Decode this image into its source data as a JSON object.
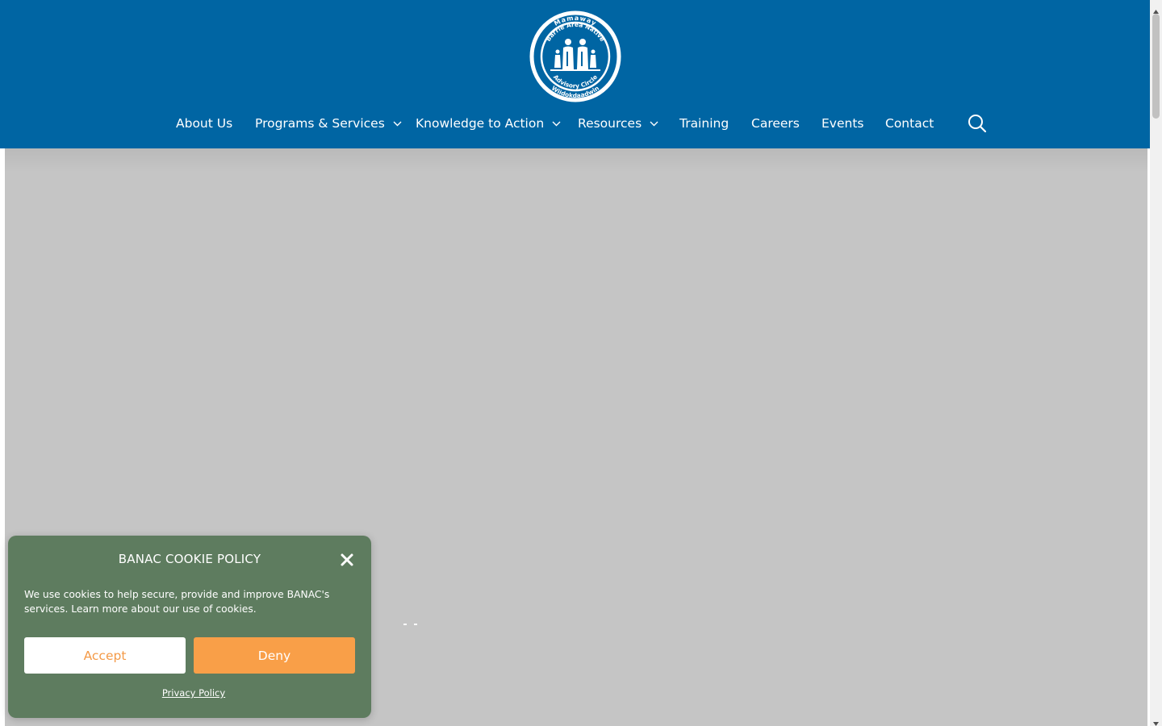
{
  "logo": {
    "ring_top": "Mamaway",
    "ring_mid": "Barrie Area Native",
    "ring_bottom1": "Advisory Circle",
    "ring_bottom2": "Wiidokdaadwin"
  },
  "nav": {
    "items": [
      {
        "label": "About Us",
        "has_dropdown": false
      },
      {
        "label": "Programs & Services",
        "has_dropdown": true
      },
      {
        "label": "Knowledge to Action",
        "has_dropdown": true
      },
      {
        "label": "Resources",
        "has_dropdown": true
      },
      {
        "label": "Training",
        "has_dropdown": false
      },
      {
        "label": "Careers",
        "has_dropdown": false
      },
      {
        "label": "Events",
        "has_dropdown": false
      },
      {
        "label": "Contact",
        "has_dropdown": false
      }
    ],
    "search_icon": "search-icon"
  },
  "cookie": {
    "title": "BANAC COOKIE POLICY",
    "text": "We use cookies to help secure, provide and improve BANAC's services. Learn more about our use of cookies.",
    "accept_label": "Accept",
    "deny_label": "Deny",
    "privacy_label": "Privacy Policy"
  },
  "colors": {
    "header_bg": "#0065a3",
    "hero_bg": "#c5c5c5",
    "cookie_bg": "#5e7c5f",
    "accent_orange": "#f99f48"
  }
}
